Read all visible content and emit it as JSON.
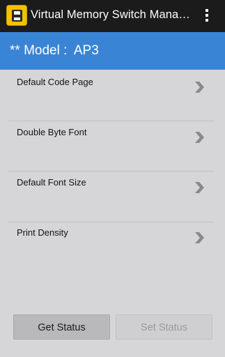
{
  "app": {
    "title": "Virtual Memory Switch Mana…"
  },
  "model": {
    "text": "** Model :  AP3"
  },
  "settings": {
    "items": [
      {
        "label": "Default Code Page"
      },
      {
        "label": "Double Byte Font"
      },
      {
        "label": "Default Font Size"
      },
      {
        "label": "Print Density"
      }
    ]
  },
  "buttons": {
    "get_status": "Get Status",
    "set_status": "Set Status",
    "set_status_enabled": false
  },
  "colors": {
    "action_bar": "#1b1b1b",
    "model_bar": "#3a84d6",
    "background": "#d6d6d8",
    "app_icon": "#f2c200"
  },
  "icons": {
    "app": "printer-icon",
    "menu": "overflow-menu-icon",
    "row": "chevron-right-icon"
  }
}
